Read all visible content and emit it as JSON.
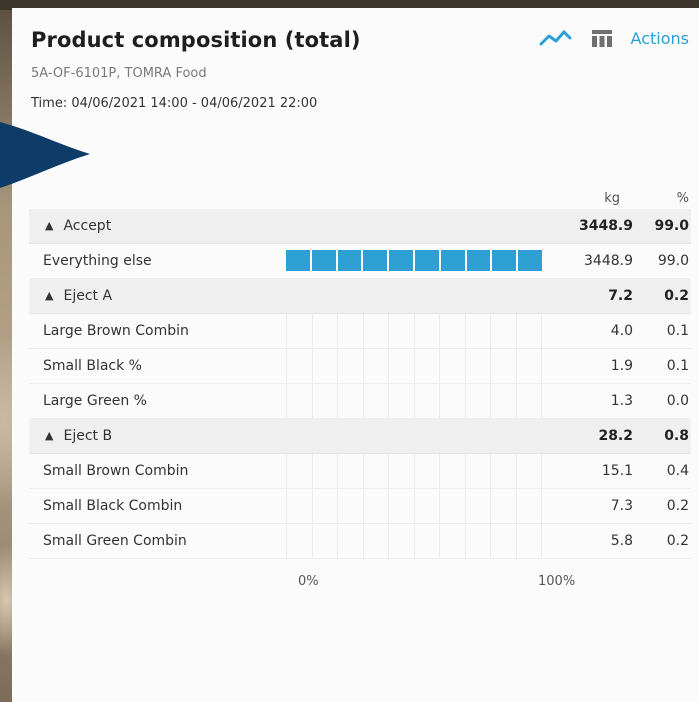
{
  "header": {
    "title": "Product composition (total)",
    "subtitle": "5A-OF-6101P, TOMRA Food",
    "time": "Time:  04/06/2021 14:00 - 04/06/2021 22:00",
    "actions_label": "Actions",
    "icons": [
      "line-chart-icon",
      "table-icon"
    ]
  },
  "colors": {
    "accent": "#2a9fd6",
    "bar": "#2e9fd3"
  },
  "columns": {
    "kg": "kg",
    "pct": "%"
  },
  "axis": {
    "min_label": "0%",
    "max_label": "100%"
  },
  "groups": [
    {
      "label": "Accept",
      "kg": "3448.9",
      "pct": "99.0",
      "items": [
        {
          "label": "Everything else",
          "kg": "3448.9",
          "pct": "99.0",
          "fill_pct": 100
        }
      ]
    },
    {
      "label": "Eject A",
      "kg": "7.2",
      "pct": "0.2",
      "items": [
        {
          "label": "Large Brown Combin",
          "kg": "4.0",
          "pct": "0.1",
          "fill_pct": 0
        },
        {
          "label": "Small Black %",
          "kg": "1.9",
          "pct": "0.1",
          "fill_pct": 0
        },
        {
          "label": "Large Green %",
          "kg": "1.3",
          "pct": "0.0",
          "fill_pct": 0
        }
      ]
    },
    {
      "label": "Eject B",
      "kg": "28.2",
      "pct": "0.8",
      "items": [
        {
          "label": "Small Brown Combin",
          "kg": "15.1",
          "pct": "0.4",
          "fill_pct": 0
        },
        {
          "label": "Small Black Combin",
          "kg": "7.3",
          "pct": "0.2",
          "fill_pct": 0
        },
        {
          "label": "Small Green Combin",
          "kg": "5.8",
          "pct": "0.2",
          "fill_pct": 0
        }
      ]
    }
  ]
}
